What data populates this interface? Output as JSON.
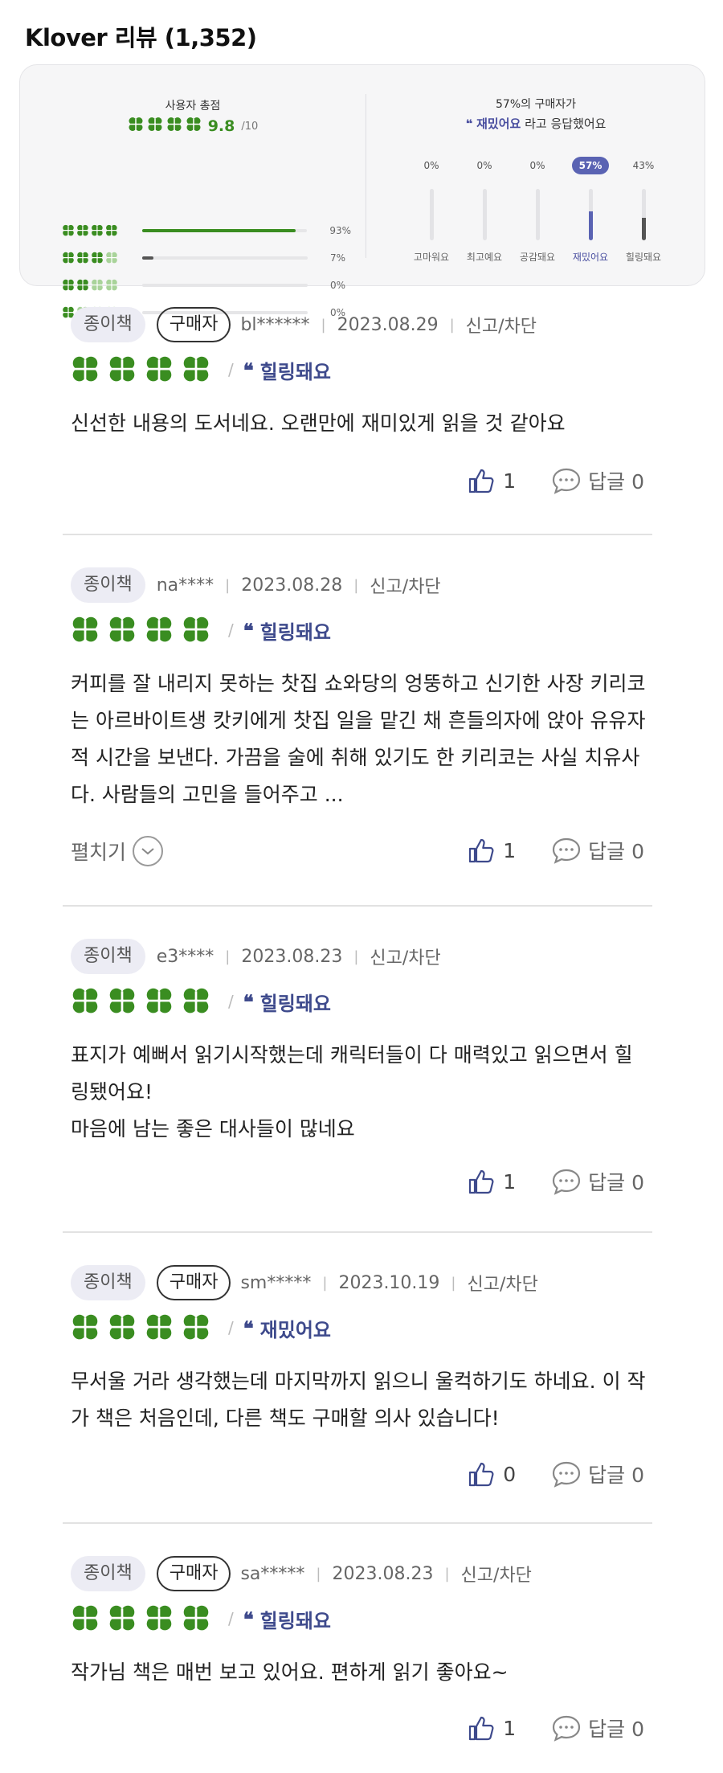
{
  "header": {
    "title": "Klover 리뷰 (1,352)"
  },
  "summary": {
    "score_label": "사용자 총점",
    "score": "9.8",
    "score_max": "/10",
    "distribution": [
      {
        "clovers": 4,
        "percent": "93%",
        "value": 0.93
      },
      {
        "clovers": 3,
        "percent": "7%",
        "value": 0.07
      },
      {
        "clovers": 2,
        "percent": "0%",
        "value": 0
      },
      {
        "clovers": 1,
        "percent": "0%",
        "value": 0
      }
    ],
    "emotion_title": "57%의 구매자가",
    "emotion_highlight": "재밌어요",
    "emotion_suffix": " 라고 응답했어요",
    "emotions": [
      {
        "label": "고마워요",
        "percent": "0%",
        "value": 0,
        "selected": false
      },
      {
        "label": "최고예요",
        "percent": "0%",
        "value": 0,
        "selected": false
      },
      {
        "label": "공감돼요",
        "percent": "0%",
        "value": 0,
        "selected": false
      },
      {
        "label": "재밌어요",
        "percent": "57%",
        "value": 0.57,
        "selected": true
      },
      {
        "label": "힐링돼요",
        "percent": "43%",
        "value": 0.43,
        "selected": false
      }
    ],
    "colors": {
      "green": "#3a8d21",
      "green_light": "#a9d39a",
      "purple": "#5a63b3",
      "dark": "#555555"
    }
  },
  "reviews": [
    {
      "type": "종이책",
      "buyer": "구매자",
      "user": "bl******",
      "date": "2023.08.29",
      "report": "신고/차단",
      "emotion": "힐링돼요",
      "text": "신선한 내용의 도서네요. 오랜만에 재미있게 읽을 것 같아요",
      "likes": "1",
      "reply": "답글 0"
    },
    {
      "type": "종이책",
      "user": "na****",
      "date": "2023.08.28",
      "report": "신고/차단",
      "emotion": "힐링돼요",
      "text": "커피를 잘 내리지 못하는 찻집 쇼와당의 엉뚱하고 신기한 사장 키리코는 아르바이트생 캇키에게 찻집 일을 맡긴 채 흔들의자에 앉아 유유자적 시간을 보낸다. 가끔을 술에 취해 있기도 한 키리코는 사실 치유사다. 사람들의 고민을 들어주고 ...",
      "expand": "펼치기",
      "likes": "1",
      "reply": "답글 0"
    },
    {
      "type": "종이책",
      "user": "e3****",
      "date": "2023.08.23",
      "report": "신고/차단",
      "emotion": "힐링돼요",
      "text": "표지가 예뻐서 읽기시작했는데 캐릭터들이 다 매력있고 읽으면서 힐링됐어요!",
      "text2": "마음에 남는 좋은 대사들이 많네요",
      "likes": "1",
      "reply": "답글 0"
    },
    {
      "type": "종이책",
      "buyer": "구매자",
      "user": "sm*****",
      "date": "2023.10.19",
      "report": "신고/차단",
      "emotion": "재밌어요",
      "text": "무서울 거라 생각했는데 마지막까지 읽으니 울컥하기도 하네요. 이 작가 책은 처음인데, 다른 책도 구매할 의사 있습니다!",
      "likes": "0",
      "reply": "답글 0"
    },
    {
      "type": "종이책",
      "buyer": "구매자",
      "user": "sa*****",
      "date": "2023.08.23",
      "report": "신고/차단",
      "emotion": "힐링돼요",
      "text": "작가님 책은 매번 보고 있어요. 편하게 읽기 좋아요~",
      "likes": "1",
      "reply": "답글 0"
    }
  ]
}
